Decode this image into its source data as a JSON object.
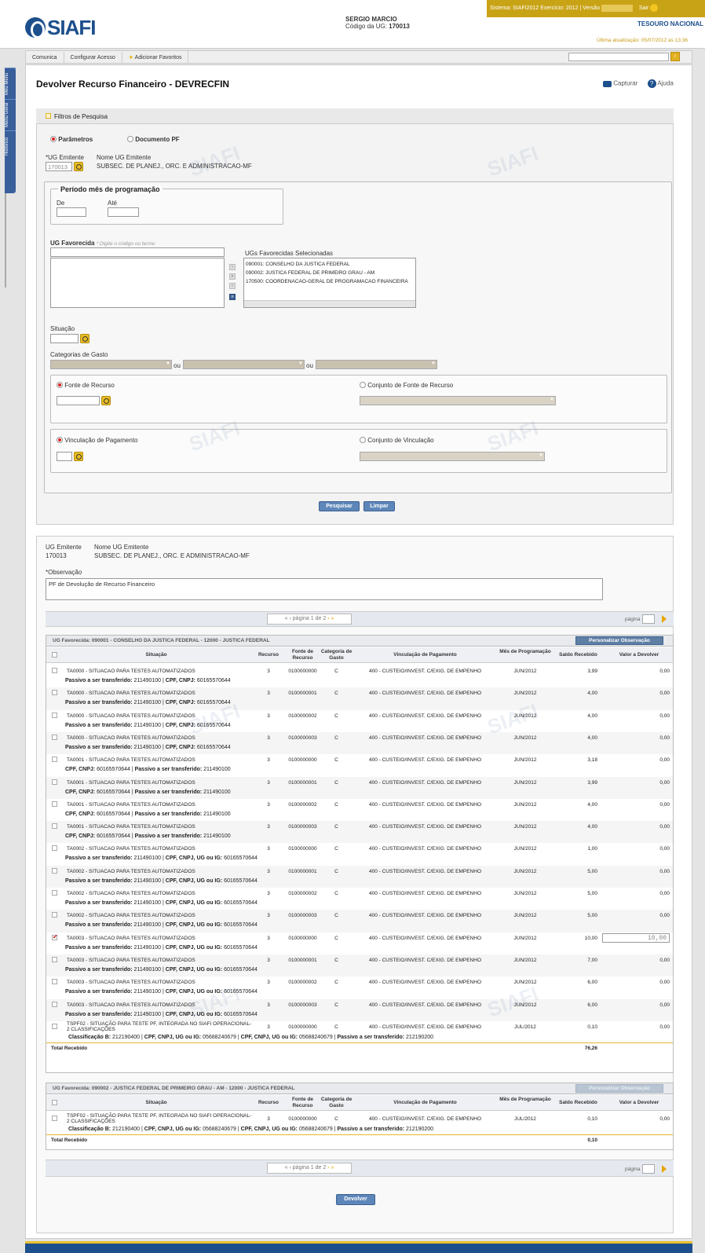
{
  "header": {
    "logo": "SIAFI",
    "user_name": "SERGIO MARCIO",
    "ug_label": "Código da UG:",
    "ug_code": "170013",
    "sistema": "Sistema: SIAFI2012 Exercício: 2012",
    "versao": "Versão",
    "sair": "Sair",
    "tesouro": "TESOURO NACIONAL",
    "ultima_atualizacao": "Última atualização: 05/07/2012 às 13:36"
  },
  "menu": {
    "items": [
      "Comunica",
      "Configurar Acesso",
      "Adicionar Favoritos"
    ]
  },
  "sidebar": {
    "items": [
      "Meu Menu",
      "Menu Geral",
      "Histórico"
    ]
  },
  "page": {
    "title": "Devolver Recurso Financeiro - DEVRECFIN",
    "capturar": "Capturar",
    "ajuda": "Ajuda"
  },
  "filtros": {
    "title": "Filtros de Pesquisa",
    "radio_parametros": "Parâmetros",
    "radio_documento": "Documento PF",
    "ug_emitente_label": "*UG Emitente",
    "ug_emitente_value": "170013",
    "nome_ug_label": "Nome UG Emitente",
    "nome_ug_value": "SUBSEC. DE PLANEJ., ORC. E ADMINISTRACAO-MF",
    "periodo_title": "Período mês de programação",
    "de": "De",
    "ate": "Até",
    "ug_favorecida_label": "UG Favorecida",
    "ug_favorecida_hint": "* Digite o código ou termo",
    "ugs_selecionadas_label": "UGs Favorecidas Selecionadas",
    "ugs_selecionadas": [
      "090001: CONSELHO DA JUSTICA FEDERAL",
      "090002: JUSTICA FEDERAL DE PRIMEIRO GRAU - AM",
      "170500: COORDENACAO-GERAL DE PROGRAMACAO FINANCEIRA"
    ],
    "situacao_label": "Situação",
    "categorias_label": "Categorias de Gasto",
    "ou": "ou",
    "fonte_recurso": "Fonte de Recurso",
    "conjunto_fonte": "Conjunto de Fonte de Recurso",
    "vinculacao": "Vinculação de Pagamento",
    "conjunto_vinculacao": "Conjunto de Vinculação",
    "pesquisar": "Pesquisar",
    "limpar": "Limpar"
  },
  "resultado": {
    "ug_emitente_label": "UG Emitente",
    "ug_emitente_value": "170013",
    "nome_ug_label": "Nome UG Emitente",
    "nome_ug_value": "SUBSEC. DE PLANEJ., ORC. E ADMINISTRACAO-MF",
    "observacao_label": "*Observação",
    "observacao_value": "PF de Devolução de Recurso Financeiro",
    "pager_text": "página 1 de 2",
    "pagina_label": "página",
    "columns": [
      "Situação",
      "Recurso",
      "Fonte de Recurso",
      "Categoria de Gasto",
      "Vinculação de Pagamento",
      "Mês de Programação",
      "Saldo Recebido",
      "Valor a Devolver"
    ],
    "personalizar": "Personalizar Observação",
    "total_label": "Total Recebido",
    "devolver": "Devolver",
    "group1": {
      "title": "UG Favorecida: 090001 - CONSELHO DA JUSTICA FEDERAL - 12000 - JUSTICA FEDERAL",
      "total": "76,26",
      "rows": [
        {
          "sit": "TA0000 - SITUACAO PARA TESTES AUTOMATIZADOS",
          "rec": "3",
          "fonte": "0100000000",
          "cat": "C",
          "vinc": "400 - CUSTEIO/INVEST. C/EXIG. DE EMPENHO",
          "mes": "JUN/2012",
          "saldo": "3,99",
          "dev": "0,00",
          "sub": [
            [
              "Passivo a ser transferido:",
              "211490100"
            ],
            [
              "CPF, CNPJ:",
              "60165570644"
            ]
          ]
        },
        {
          "sit": "TA0000 - SITUACAO PARA TESTES AUTOMATIZADOS",
          "rec": "3",
          "fonte": "0100000001",
          "cat": "C",
          "vinc": "400 - CUSTEIO/INVEST. C/EXIG. DE EMPENHO",
          "mes": "JUN/2012",
          "saldo": "4,00",
          "dev": "0,00",
          "sub": [
            [
              "Passivo a ser transferido:",
              "211490100"
            ],
            [
              "CPF, CNPJ:",
              "60165570644"
            ]
          ]
        },
        {
          "sit": "TA0000 - SITUACAO PARA TESTES AUTOMATIZADOS",
          "rec": "3",
          "fonte": "0100000002",
          "cat": "C",
          "vinc": "400 - CUSTEIO/INVEST. C/EXIG. DE EMPENHO",
          "mes": "JUN/2012",
          "saldo": "4,00",
          "dev": "0,00",
          "sub": [
            [
              "Passivo a ser transferido:",
              "211490100"
            ],
            [
              "CPF, CNPJ:",
              "60165570644"
            ]
          ]
        },
        {
          "sit": "TA0000 - SITUACAO PARA TESTES AUTOMATIZADOS",
          "rec": "3",
          "fonte": "0100000003",
          "cat": "C",
          "vinc": "400 - CUSTEIO/INVEST. C/EXIG. DE EMPENHO",
          "mes": "JUN/2012",
          "saldo": "4,00",
          "dev": "0,00",
          "sub": [
            [
              "Passivo a ser transferido:",
              "211490100"
            ],
            [
              "CPF, CNPJ:",
              "60165570644"
            ]
          ]
        },
        {
          "sit": "TA0001 - SITUACAO PARA TESTES AUTOMATIZADOS",
          "rec": "3",
          "fonte": "0100000000",
          "cat": "C",
          "vinc": "400 - CUSTEIO/INVEST. C/EXIG. DE EMPENHO",
          "mes": "JUN/2012",
          "saldo": "3,18",
          "dev": "0,00",
          "sub": [
            [
              "CPF, CNPJ:",
              "60165570644"
            ],
            [
              "Passivo a ser transferido:",
              "211490100"
            ]
          ]
        },
        {
          "sit": "TA0001 - SITUACAO PARA TESTES AUTOMATIZADOS",
          "rec": "3",
          "fonte": "0100000001",
          "cat": "C",
          "vinc": "400 - CUSTEIO/INVEST. C/EXIG. DE EMPENHO",
          "mes": "JUN/2012",
          "saldo": "3,99",
          "dev": "0,00",
          "sub": [
            [
              "CPF, CNPJ:",
              "60165570644"
            ],
            [
              "Passivo a ser transferido:",
              "211490100"
            ]
          ]
        },
        {
          "sit": "TA0001 - SITUACAO PARA TESTES AUTOMATIZADOS",
          "rec": "3",
          "fonte": "0100000002",
          "cat": "C",
          "vinc": "400 - CUSTEIO/INVEST. C/EXIG. DE EMPENHO",
          "mes": "JUN/2012",
          "saldo": "4,00",
          "dev": "0,00",
          "sub": [
            [
              "CPF, CNPJ:",
              "60165570644"
            ],
            [
              "Passivo a ser transferido:",
              "211490100"
            ]
          ]
        },
        {
          "sit": "TA0001 - SITUACAO PARA TESTES AUTOMATIZADOS",
          "rec": "3",
          "fonte": "0100000003",
          "cat": "C",
          "vinc": "400 - CUSTEIO/INVEST. C/EXIG. DE EMPENHO",
          "mes": "JUN/2012",
          "saldo": "4,00",
          "dev": "0,00",
          "sub": [
            [
              "CPF, CNPJ:",
              "60165570644"
            ],
            [
              "Passivo a ser transferido:",
              "211490100"
            ]
          ]
        },
        {
          "sit": "TA0002 - SITUACAO PARA TESTES AUTOMATIZADOS",
          "rec": "3",
          "fonte": "0100000000",
          "cat": "C",
          "vinc": "400 - CUSTEIO/INVEST. C/EXIG. DE EMPENHO",
          "mes": "JUN/2012",
          "saldo": "1,00",
          "dev": "0,00",
          "sub": [
            [
              "Passivo a ser transferido:",
              "211490100"
            ],
            [
              "CPF, CNPJ, UG ou IG:",
              "60165570644"
            ]
          ]
        },
        {
          "sit": "TA0002 - SITUACAO PARA TESTES AUTOMATIZADOS",
          "rec": "3",
          "fonte": "0100000001",
          "cat": "C",
          "vinc": "400 - CUSTEIO/INVEST. C/EXIG. DE EMPENHO",
          "mes": "JUN/2012",
          "saldo": "5,00",
          "dev": "0,00",
          "sub": [
            [
              "Passivo a ser transferido:",
              "211490100"
            ],
            [
              "CPF, CNPJ, UG ou IG:",
              "60165570644"
            ]
          ]
        },
        {
          "sit": "TA0002 - SITUACAO PARA TESTES AUTOMATIZADOS",
          "rec": "3",
          "fonte": "0100000002",
          "cat": "C",
          "vinc": "400 - CUSTEIO/INVEST. C/EXIG. DE EMPENHO",
          "mes": "JUN/2012",
          "saldo": "5,00",
          "dev": "0,00",
          "sub": [
            [
              "Passivo a ser transferido:",
              "211490100"
            ],
            [
              "CPF, CNPJ, UG ou IG:",
              "60165570644"
            ]
          ]
        },
        {
          "sit": "TA0002 - SITUACAO PARA TESTES AUTOMATIZADOS",
          "rec": "3",
          "fonte": "0100000003",
          "cat": "C",
          "vinc": "400 - CUSTEIO/INVEST. C/EXIG. DE EMPENHO",
          "mes": "JUN/2012",
          "saldo": "5,00",
          "dev": "0,00",
          "sub": [
            [
              "Passivo a ser transferido:",
              "211490100"
            ],
            [
              "CPF, CNPJ, UG ou IG:",
              "60165570644"
            ]
          ]
        },
        {
          "sit": "TA0003 - SITUACAO PARA TESTES AUTOMATIZADOS",
          "rec": "3",
          "fonte": "0100000000",
          "cat": "C",
          "vinc": "400 - CUSTEIO/INVEST. C/EXIG. DE EMPENHO",
          "mes": "JUN/2012",
          "saldo": "10,00",
          "dev": "10,00",
          "checked": true,
          "sub": [
            [
              "Passivo a ser transferido:",
              "211490100"
            ],
            [
              "CPF, CNPJ, UG ou IG:",
              "60165570644"
            ]
          ]
        },
        {
          "sit": "TA0003 - SITUACAO PARA TESTES AUTOMATIZADOS",
          "rec": "3",
          "fonte": "0100000001",
          "cat": "C",
          "vinc": "400 - CUSTEIO/INVEST. C/EXIG. DE EMPENHO",
          "mes": "JUN/2012",
          "saldo": "7,00",
          "dev": "0,00",
          "sub": [
            [
              "Passivo a ser transferido:",
              "211490100"
            ],
            [
              "CPF, CNPJ, UG ou IG:",
              "60165570644"
            ]
          ]
        },
        {
          "sit": "TA0003 - SITUACAO PARA TESTES AUTOMATIZADOS",
          "rec": "3",
          "fonte": "0100000002",
          "cat": "C",
          "vinc": "400 - CUSTEIO/INVEST. C/EXIG. DE EMPENHO",
          "mes": "JUN/2012",
          "saldo": "6,00",
          "dev": "0,00",
          "sub": [
            [
              "Passivo a ser transferido:",
              "211490100"
            ],
            [
              "CPF, CNPJ, UG ou IG:",
              "60165570644"
            ]
          ]
        },
        {
          "sit": "TA0003 - SITUACAO PARA TESTES AUTOMATIZADOS",
          "rec": "3",
          "fonte": "0100000003",
          "cat": "C",
          "vinc": "400 - CUSTEIO/INVEST. C/EXIG. DE EMPENHO",
          "mes": "JUN/2012",
          "saldo": "6,00",
          "dev": "0,00",
          "sub": [
            [
              "Passivo a ser transferido:",
              "211490100"
            ],
            [
              "CPF, CNPJ, UG ou IG:",
              "60165570644"
            ]
          ]
        },
        {
          "sit": "TSPF02 - SITUAÇÃO PARA TESTE PF, INTEGRADA NO SIAFI OPERACIONAL- 2 CLASSIFICAÇÕES",
          "rec": "3",
          "fonte": "0100000000",
          "cat": "C",
          "vinc": "400 - CUSTEIO/INVEST. C/EXIG. DE EMPENHO",
          "mes": "JUL/2012",
          "saldo": "0,10",
          "dev": "0,00",
          "sub": [
            [
              "Classificação B:",
              "212190400"
            ],
            [
              "CPF, CNPJ, UG ou IG:",
              "05688240679"
            ],
            [
              "CPF, CNPJ, UG ou IG:",
              "05688240679"
            ],
            [
              "Passivo a ser transferido:",
              "212190200"
            ]
          ]
        }
      ]
    },
    "group2": {
      "title": "UG Favorecida: 090002 - JUSTICA FEDERAL DE PRIMEIRO GRAU - AM - 12000 - JUSTICA FEDERAL",
      "total": "0,10",
      "rows": [
        {
          "sit": "TSPF02 - SITUAÇÃO PARA TESTE PF, INTEGRADA NO SIAFI OPERACIONAL- 2 CLASSIFICAÇÕES",
          "rec": "3",
          "fonte": "0100000000",
          "cat": "C",
          "vinc": "400 - CUSTEIO/INVEST. C/EXIG. DE EMPENHO",
          "mes": "JUL/2012",
          "saldo": "0,10",
          "dev": "0,00",
          "sub": [
            [
              "Classificação B:",
              "212190400"
            ],
            [
              "CPF, CNPJ, UG ou IG:",
              "05688240679"
            ],
            [
              "CPF, CNPJ, UG ou IG:",
              "05688240679"
            ],
            [
              "Passivo a ser transferido:",
              "212190200"
            ]
          ]
        }
      ]
    }
  },
  "colors": {
    "brand": "#1d4f8c",
    "accent": "#e8c02b",
    "button": "#5d86b9"
  }
}
